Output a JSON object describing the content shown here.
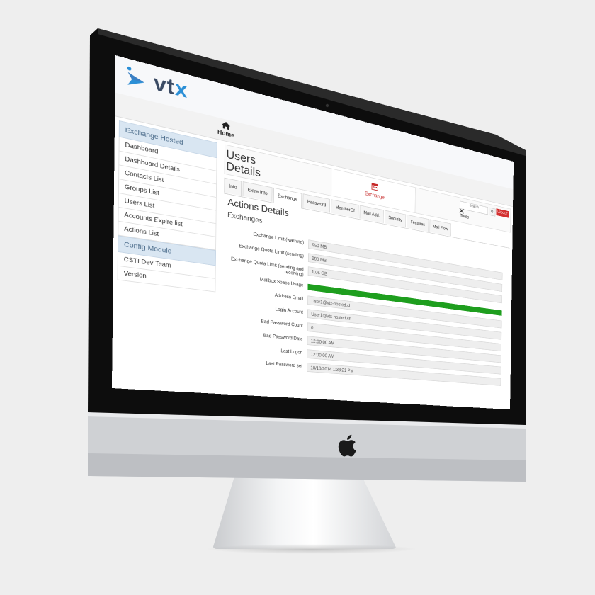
{
  "brand": {
    "logo_text_main": "vt",
    "logo_text_accent": "x"
  },
  "nav": {
    "home_label": "Home"
  },
  "sidebar": {
    "sections": [
      {
        "header": "Exchange Hosted",
        "items": [
          "Dashboard",
          "Dashboard Details",
          "Contacts List",
          "Groups List",
          "Users List",
          "Accounts Expire list",
          "Actions List"
        ]
      },
      {
        "header": "Config Module",
        "items": [
          "CSTI Dev Team",
          "Version"
        ]
      }
    ]
  },
  "modules": {
    "exchange_label": "Exchange",
    "tools_label": "Tools",
    "search_placeholder": "Search",
    "search_button": "Q",
    "logout_label": "LOGOUT"
  },
  "page": {
    "title": "Users Details"
  },
  "tabs": [
    "Info",
    "Extra Info",
    "Exchange",
    "Password",
    "MemberOf",
    "Mail Add.",
    "Security",
    "Features",
    "Mail Flow"
  ],
  "active_tab": "Exchange",
  "section": {
    "title": "Actions Details",
    "subtitle": "Exchanges"
  },
  "fields": [
    {
      "label": "Exchange Limit (warning)",
      "value": "950 MB"
    },
    {
      "label": "Exchange Quota Limit (sending)",
      "value": "990 MB"
    },
    {
      "label": "Exchange Quota Limit (sending and receiving)",
      "value": "1.05 GB"
    },
    {
      "label": "Mailbox Space Usage",
      "value": ""
    },
    {
      "label": "Address Email",
      "value": "User1@vtx-hosted.ch"
    },
    {
      "label": "Login Account",
      "value": "User1@vtx-hosted.ch"
    },
    {
      "label": "Bad Password Count",
      "value": "0"
    },
    {
      "label": "Bad Password Date",
      "value": "12:00:00 AM"
    },
    {
      "label": "Last Logon",
      "value": "12:00:00 AM"
    },
    {
      "label": "Last Password set",
      "value": "10/10/2014 1:33:21 PM"
    }
  ],
  "mailbox_usage_fraction": 1.0,
  "colors": {
    "accent_red": "#d32f2f",
    "usage_green": "#1e9e1e",
    "brand_blue": "#2b8fd6",
    "brand_dark": "#3a4a63"
  }
}
